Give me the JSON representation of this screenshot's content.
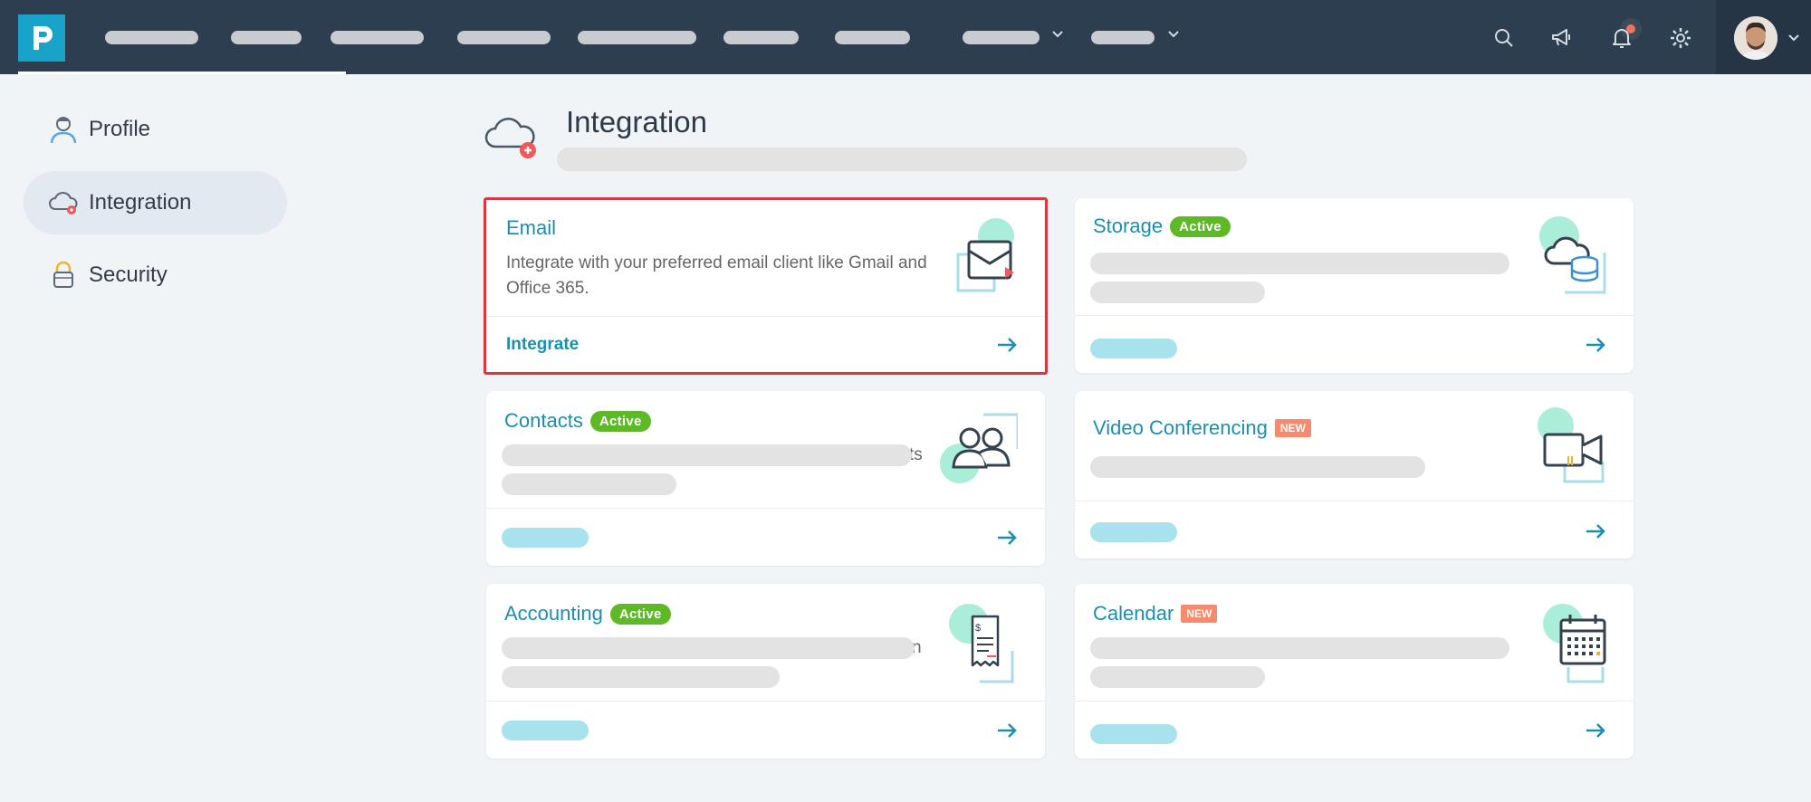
{
  "sidebar": {
    "items": [
      {
        "label": "Profile",
        "icon": "user-icon"
      },
      {
        "label": "Integration",
        "icon": "cloud-icon"
      },
      {
        "label": "Security",
        "icon": "lock-icon"
      }
    ]
  },
  "page": {
    "title": "Integration"
  },
  "cards": {
    "email": {
      "title": "Email",
      "description": "Integrate with your preferred email client like Gmail and Office 365.",
      "link": "Integrate"
    },
    "storage": {
      "title": "Storage",
      "badge": "Active"
    },
    "contacts": {
      "title": "Contacts",
      "badge": "Active",
      "ghost": "ts"
    },
    "video": {
      "title": "Video Conferencing",
      "badge": "NEW"
    },
    "accounting": {
      "title": "Accounting",
      "badge": "Active",
      "ghost": "n"
    },
    "calendar": {
      "title": "Calendar",
      "badge": "NEW"
    }
  },
  "colors": {
    "topbar": "#2c3e50",
    "accent": "#1b8fae",
    "active_badge": "#5eb927",
    "new_badge": "#f58a6c",
    "highlight": "#d9363e"
  }
}
